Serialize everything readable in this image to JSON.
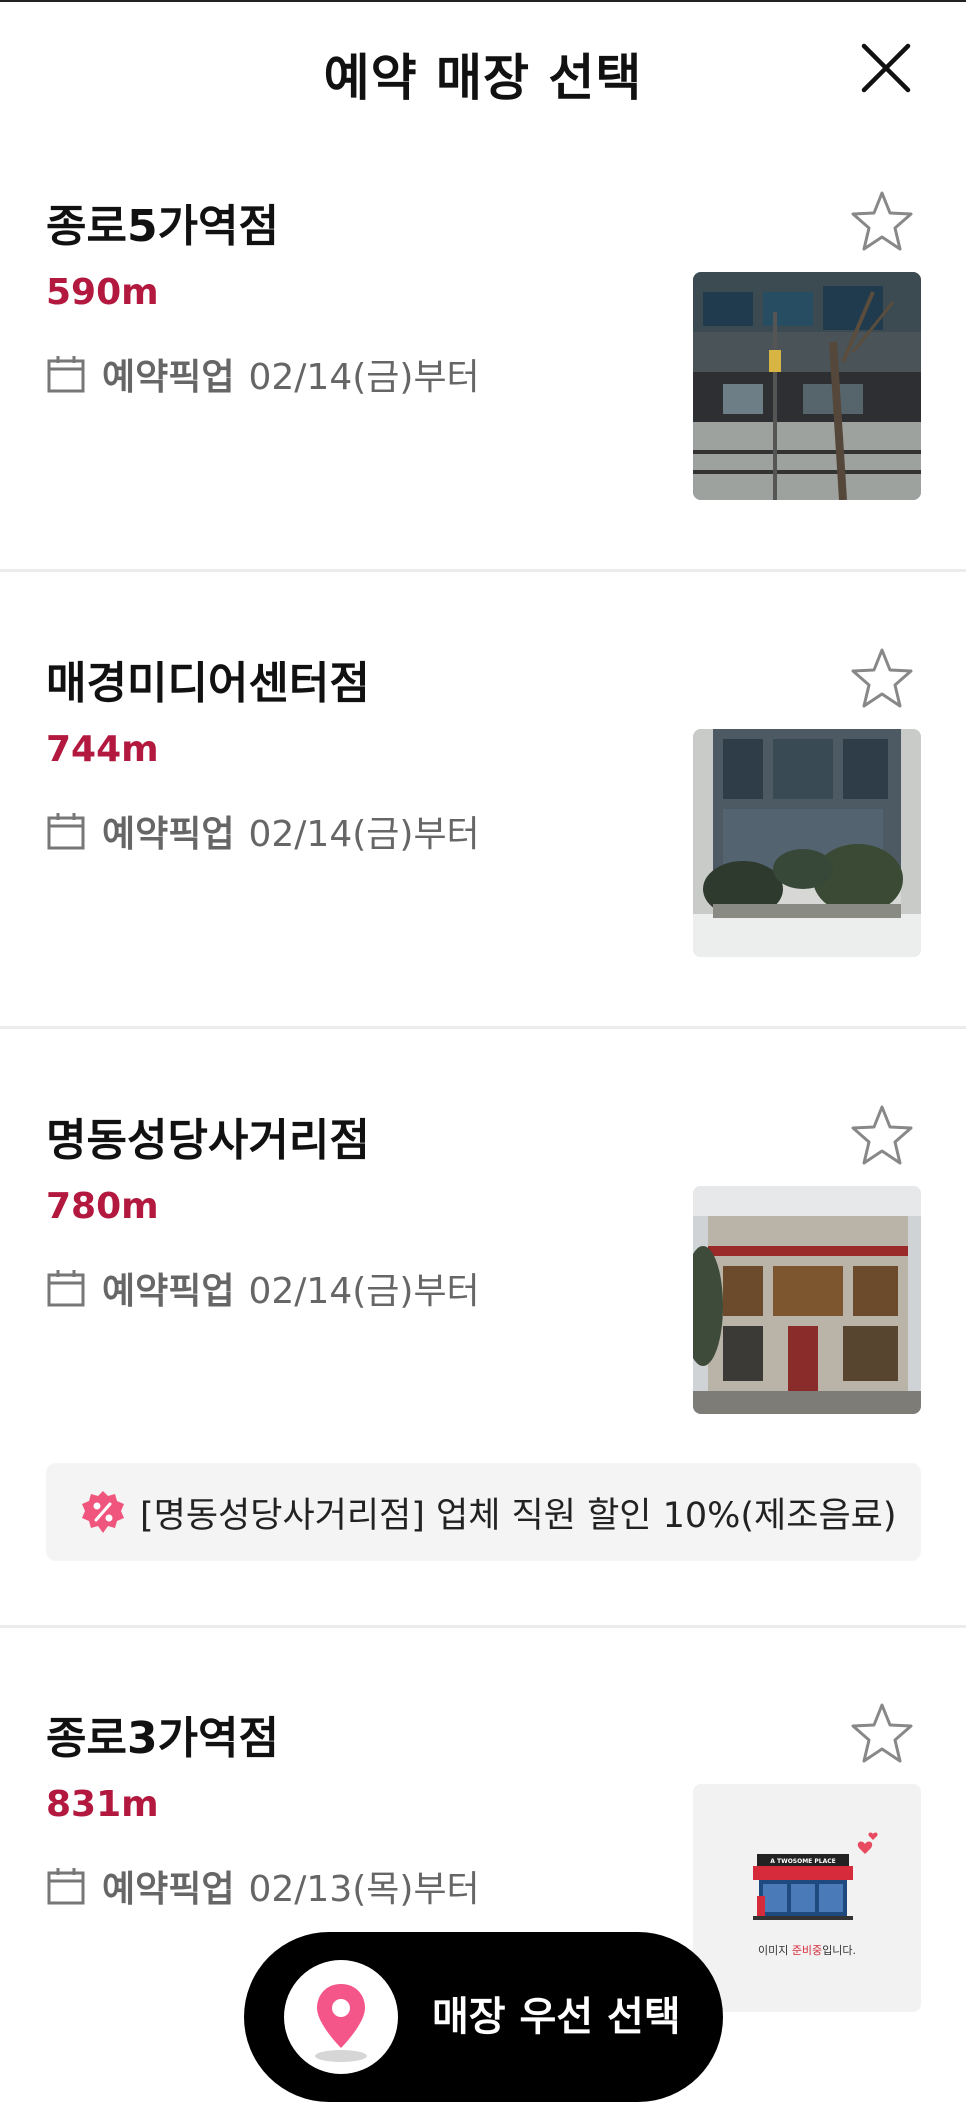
{
  "header": {
    "title": "예약 매장 선택",
    "close_icon": "close-icon"
  },
  "stores": [
    {
      "name": "종로5가역점",
      "distance": "590m",
      "pickup_label": "예약픽업",
      "pickup_date": "02/14(금)부터",
      "favorite_icon": "star-outline-icon"
    },
    {
      "name": "매경미디어센터점",
      "distance": "744m",
      "pickup_label": "예약픽업",
      "pickup_date": "02/14(금)부터",
      "favorite_icon": "star-outline-icon"
    },
    {
      "name": "명동성당사거리점",
      "distance": "780m",
      "pickup_label": "예약픽업",
      "pickup_date": "02/14(금)부터",
      "favorite_icon": "star-outline-icon",
      "promo": "[명동성당사거리점] 업체 직원 할인 10%(제조음료)"
    },
    {
      "name": "종로3가역점",
      "distance": "831m",
      "pickup_label": "예약픽업",
      "pickup_date": "02/13(목)부터",
      "favorite_icon": "star-outline-icon",
      "placeholder_text_a": "이미지 ",
      "placeholder_text_b": "준비중",
      "placeholder_text_c": "입니다.",
      "placeholder_sign": "A TWOSOME PLACE"
    }
  ],
  "floating_button": {
    "label": "매장 우선 선택",
    "icon": "location-pin-icon"
  },
  "colors": {
    "accent": "#b3183f",
    "pin": "#f4568a",
    "promo_bg": "#f4f4f4",
    "divider": "#ececec"
  }
}
